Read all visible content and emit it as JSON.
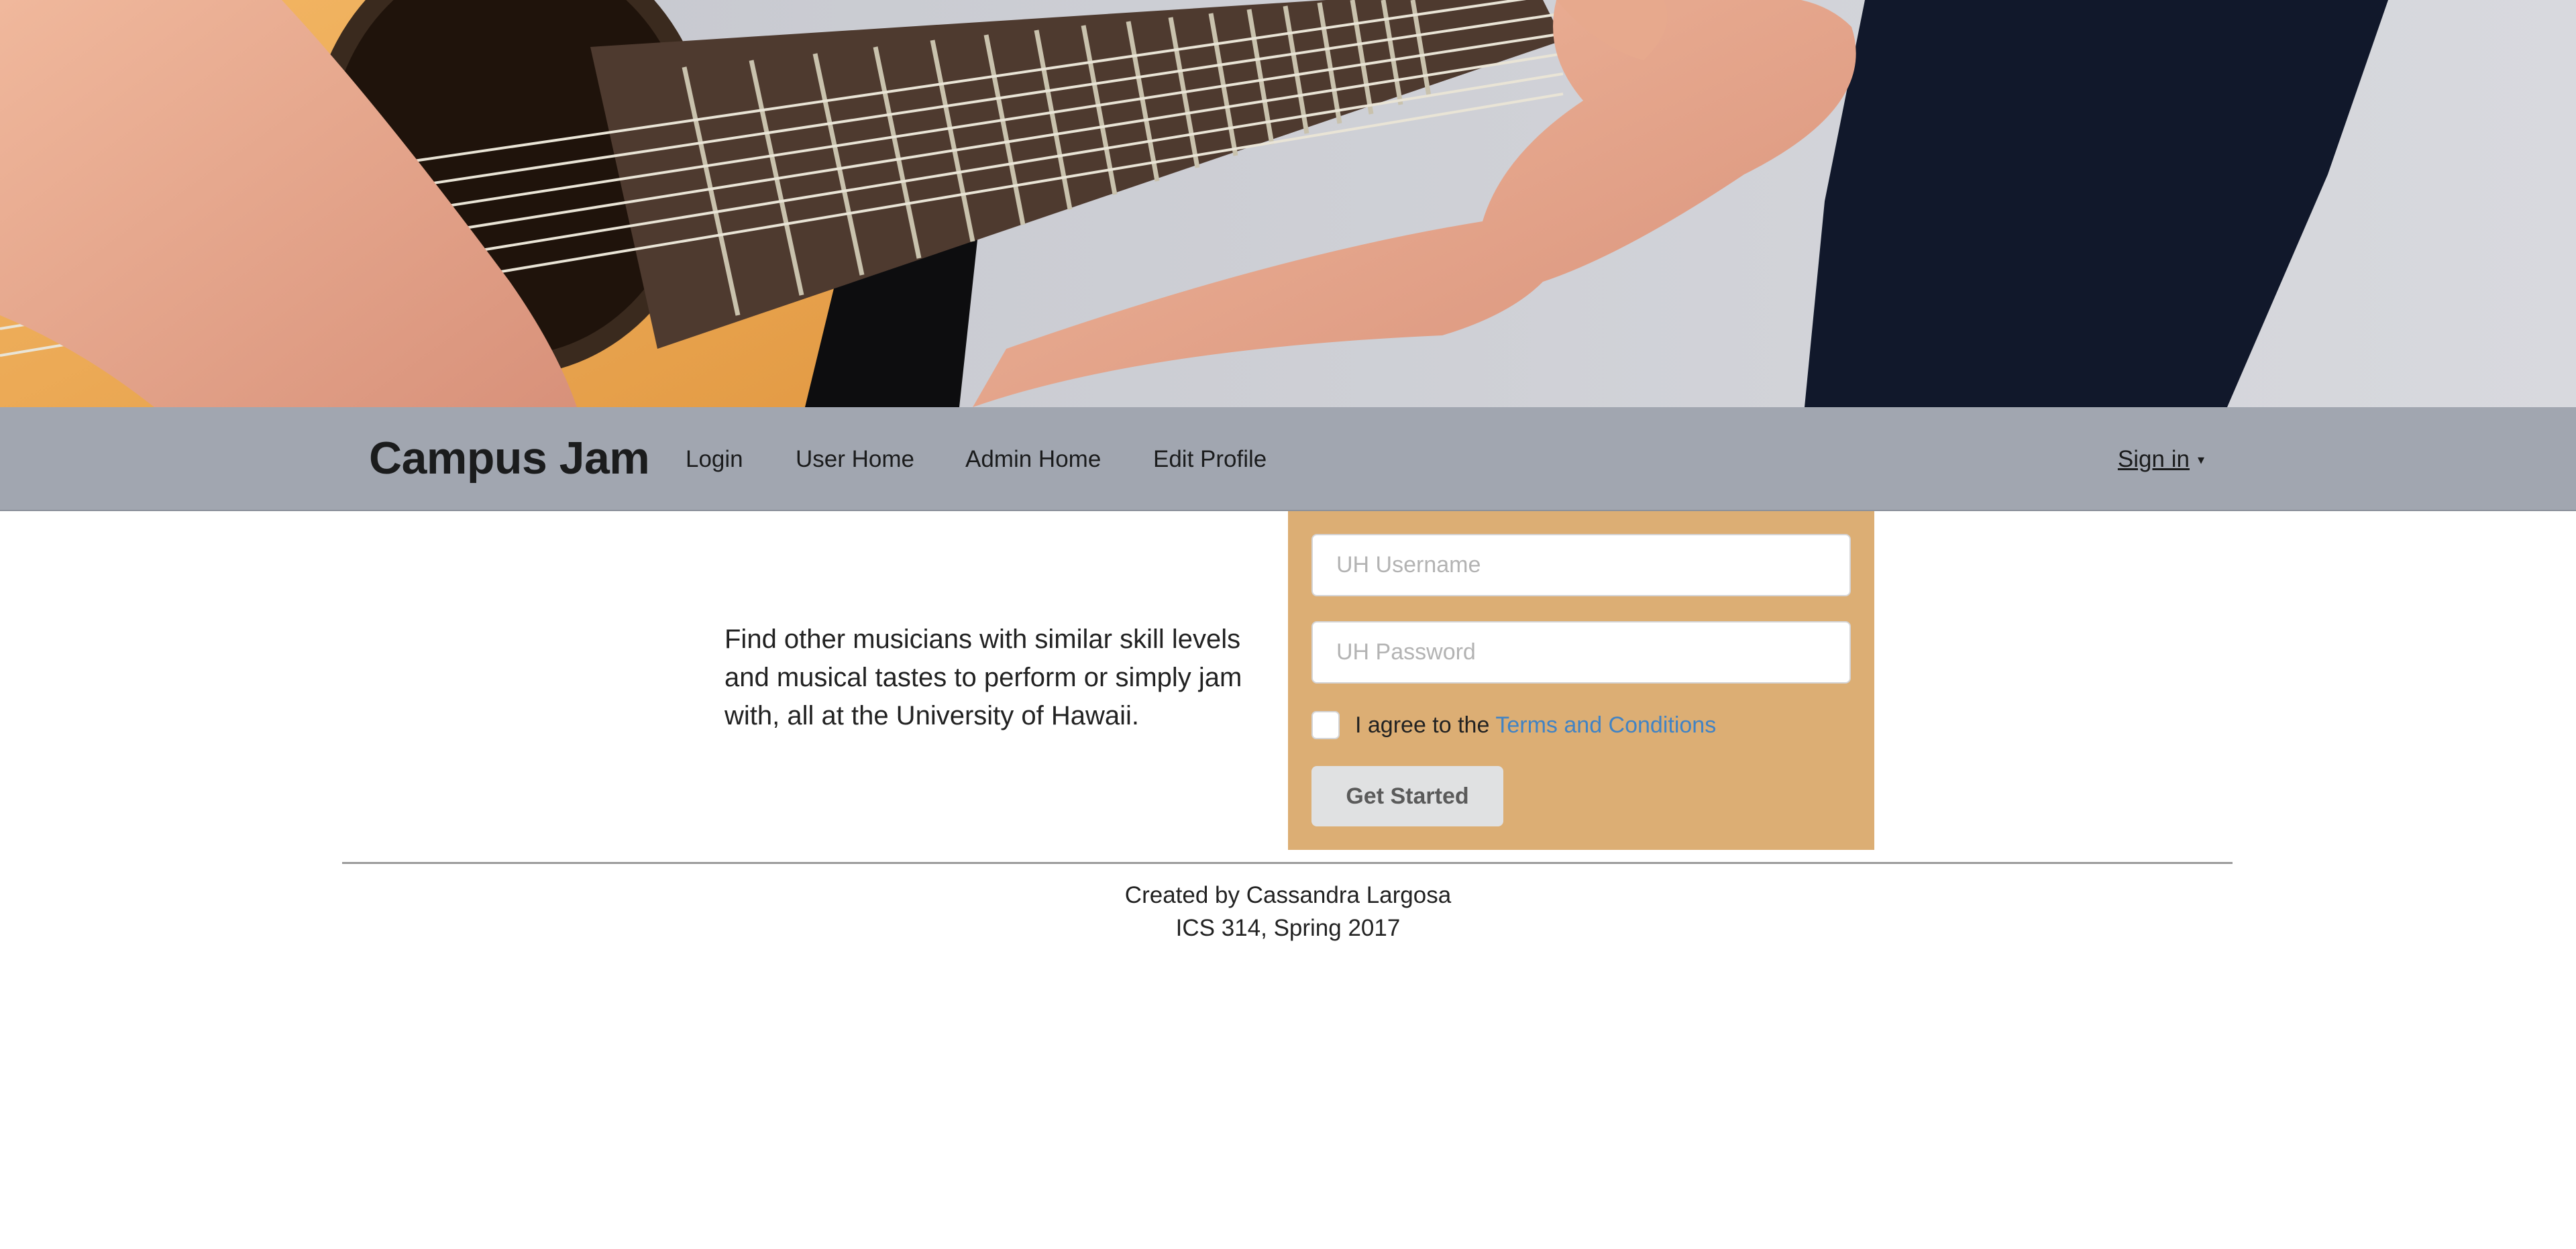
{
  "hero": {
    "icon": "guitar-photo"
  },
  "navbar": {
    "brand": "Campus Jam",
    "items": [
      {
        "label": "Login"
      },
      {
        "label": "User Home"
      },
      {
        "label": "Admin Home"
      },
      {
        "label": "Edit Profile"
      }
    ],
    "signin_label": "Sign in",
    "signin_caret": "▾",
    "background_color": "#a1a6b0"
  },
  "main": {
    "tagline": "Find other musicians with similar skill levels and musical tastes to perform or simply jam with, all at the University of Hawaii."
  },
  "login_form": {
    "username_placeholder": "UH Username",
    "password_placeholder": "UH Password",
    "agree_text": "I agree to the",
    "terms_link": "Terms and Conditions",
    "submit_label": "Get Started",
    "panel_color": "#dcae74",
    "link_color": "#4183c4"
  },
  "footer": {
    "line1": "Created by Cassandra Largosa",
    "line2": "ICS 314, Spring 2017"
  }
}
